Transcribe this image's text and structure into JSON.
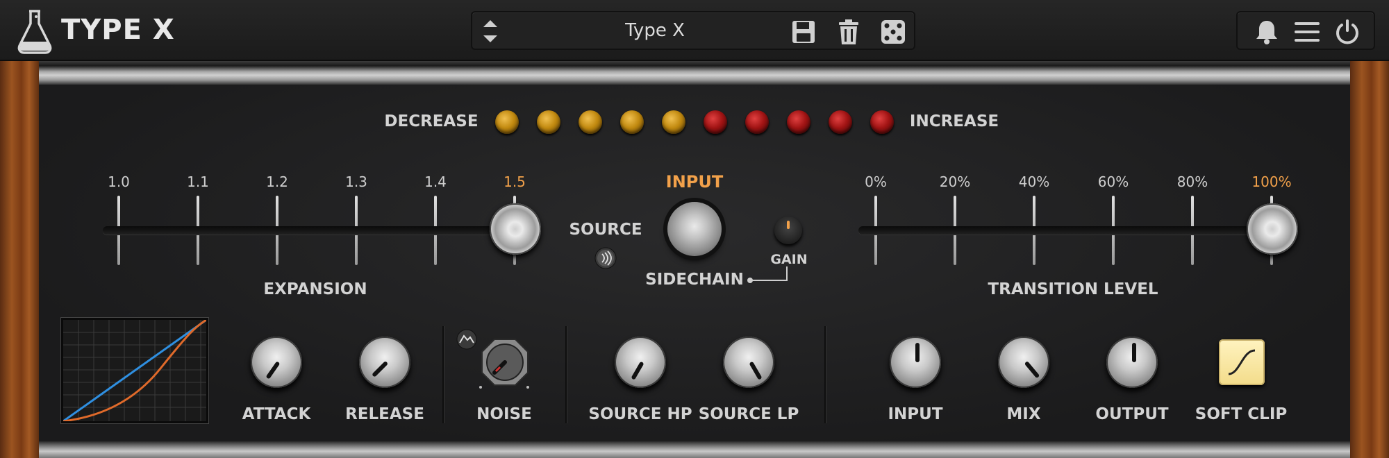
{
  "app": {
    "title": "TYPE X",
    "preset_name": "Type X"
  },
  "header": {
    "icons": [
      "flask-icon",
      "preset-up-down-icon",
      "save-icon",
      "trash-icon",
      "dice-icon",
      "bell-icon",
      "menu-icon",
      "power-icon"
    ]
  },
  "meter": {
    "decrease_label": "DECREASE",
    "increase_label": "INCREASE",
    "leds": [
      "amber",
      "amber",
      "amber",
      "amber",
      "amber",
      "red",
      "red",
      "red",
      "red",
      "red"
    ]
  },
  "expansion": {
    "label": "EXPANSION",
    "ticks": [
      "1.0",
      "1.1",
      "1.2",
      "1.3",
      "1.4",
      "1.5"
    ],
    "value": "1.5"
  },
  "center": {
    "input_label": "INPUT",
    "source_label": "SOURCE",
    "sidechain_label": "SIDECHAIN",
    "gain_label": "GAIN"
  },
  "transition": {
    "label": "TRANSITION LEVEL",
    "ticks": [
      "0%",
      "20%",
      "40%",
      "60%",
      "80%",
      "100%"
    ],
    "value": "100%"
  },
  "knobs": {
    "attack": "ATTACK",
    "release": "RELEASE",
    "noise": "NOISE",
    "source_hp": "SOURCE HP",
    "source_lp": "SOURCE LP",
    "input": "INPUT",
    "mix": "MIX",
    "output": "OUTPUT",
    "soft_clip": "SOFT CLIP"
  },
  "colors": {
    "accent": "#f2a14a",
    "curve_blue": "#2f8fe0",
    "curve_orange": "#e06a2a"
  }
}
